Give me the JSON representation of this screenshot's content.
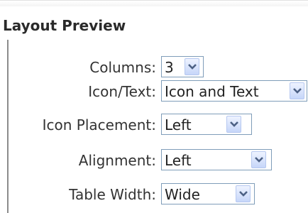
{
  "panel": {
    "title": "Layout Preview",
    "fields": [
      {
        "label": "Columns:",
        "value": "3"
      },
      {
        "label": "Icon/Text:",
        "value": "Icon and Text"
      },
      {
        "label": "Icon Placement:",
        "value": "Left"
      },
      {
        "label": "Alignment:",
        "value": "Left"
      },
      {
        "label": "Table Width:",
        "value": "Wide"
      }
    ]
  },
  "icons": {
    "dropdown": "chevron-down-icon"
  },
  "colors": {
    "select_border": "#7f9db9",
    "arrow_button": "#c6d6f9",
    "arrow_glyph": "#4d6185"
  }
}
